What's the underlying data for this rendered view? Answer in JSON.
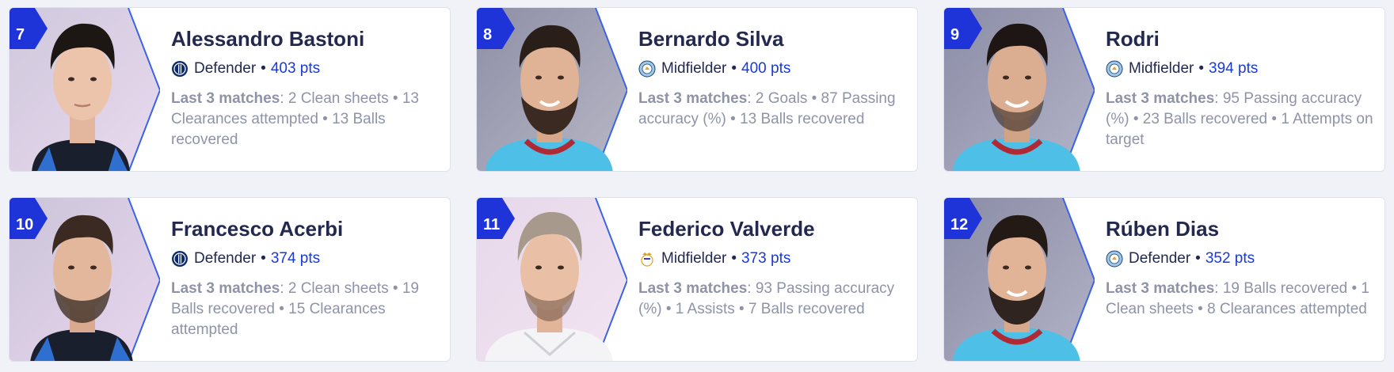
{
  "colors": {
    "accent": "#1a3ad6",
    "name": "#23284f",
    "muted": "#8e93a8",
    "rank_bg": "#1e33d8"
  },
  "cards": [
    {
      "rank": "7",
      "name": "Alessandro Bastoni",
      "club_icon": "inter-crest-icon",
      "position": "Defender",
      "points": "403 pts",
      "stats_label": "Last 3 matches",
      "stats_text": "2 Clean sheets • 13 Clearances attempted • 13 Balls recovered"
    },
    {
      "rank": "8",
      "name": "Bernardo Silva",
      "club_icon": "man-city-crest-icon",
      "position": "Midfielder",
      "points": "400 pts",
      "stats_label": "Last 3 matches",
      "stats_text": "2 Goals • 87 Passing accuracy (%) • 13 Balls recovered"
    },
    {
      "rank": "9",
      "name": "Rodri",
      "club_icon": "man-city-crest-icon",
      "position": "Midfielder",
      "points": "394 pts",
      "stats_label": "Last 3 matches",
      "stats_text": "95 Passing accuracy (%) • 23 Balls recovered • 1 Attempts on target"
    },
    {
      "rank": "10",
      "name": "Francesco Acerbi",
      "club_icon": "inter-crest-icon",
      "position": "Defender",
      "points": "374 pts",
      "stats_label": "Last 3 matches",
      "stats_text": "2 Clean sheets • 19 Balls recovered • 15 Clearances attempted"
    },
    {
      "rank": "11",
      "name": "Federico Valverde",
      "club_icon": "real-madrid-crest-icon",
      "position": "Midfielder",
      "points": "373 pts",
      "stats_label": "Last 3 matches",
      "stats_text": "93 Passing accuracy (%) • 1 Assists • 7 Balls recovered"
    },
    {
      "rank": "12",
      "name": "Rúben Dias",
      "club_icon": "man-city-crest-icon",
      "position": "Defender",
      "points": "352 pts",
      "stats_label": "Last 3 matches",
      "stats_text": "19 Balls recovered • 1 Clean sheets • 8 Clearances attempted"
    }
  ]
}
